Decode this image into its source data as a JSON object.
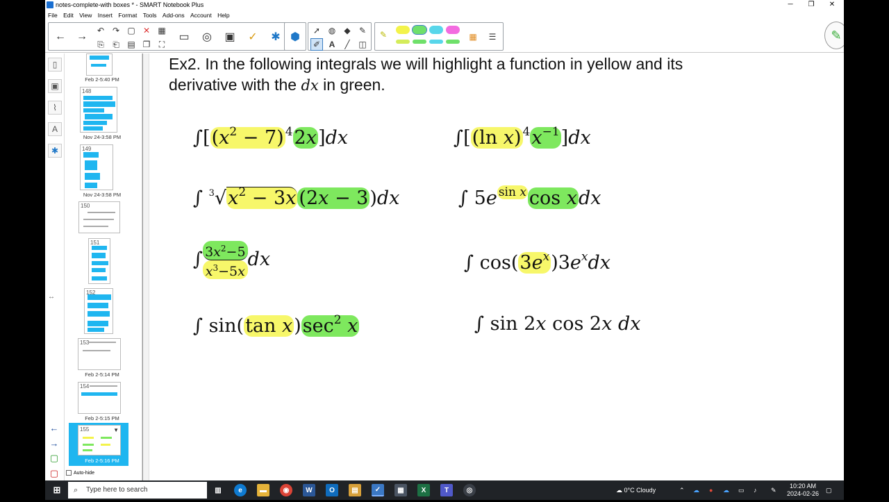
{
  "window": {
    "title": "notes-complete-with boxes * - SMART Notebook Plus",
    "minimize": "─",
    "restore": "❐",
    "close": "✕"
  },
  "menu": [
    "File",
    "Edit",
    "View",
    "Insert",
    "Format",
    "Tools",
    "Add-ons",
    "Account",
    "Help"
  ],
  "toolbar": {
    "buttons": [
      {
        "name": "previous-page-button",
        "glyph": "←"
      },
      {
        "name": "next-page-button",
        "glyph": "→"
      },
      {
        "name": "undo-button",
        "glyph": "↶"
      },
      {
        "name": "redo-button",
        "glyph": "↷"
      },
      {
        "name": "add-page-button",
        "glyph": "▢"
      },
      {
        "name": "delete-button",
        "glyph": "✕"
      },
      {
        "name": "table-button",
        "glyph": "▦"
      },
      {
        "name": "screen-shade-button",
        "glyph": "▭"
      },
      {
        "name": "capture-button",
        "glyph": "◎"
      },
      {
        "name": "document-camera-button",
        "glyph": "▣"
      },
      {
        "name": "response-button",
        "glyph": "✓"
      },
      {
        "name": "addons-button",
        "glyph": "✱"
      },
      {
        "name": "lab-button",
        "glyph": "⬢"
      }
    ],
    "tools": [
      {
        "name": "select-tool",
        "glyph": "➚"
      },
      {
        "name": "shapes-tool",
        "glyph": "◍"
      },
      {
        "name": "fill-tool",
        "glyph": "◆"
      },
      {
        "name": "magic-pen-tool",
        "glyph": "✎"
      },
      {
        "name": "pen-tool",
        "glyph": "✐"
      },
      {
        "name": "text-tool",
        "glyph": "A"
      },
      {
        "name": "line-tool",
        "glyph": "╱"
      },
      {
        "name": "eraser-tool",
        "glyph": "◫"
      }
    ],
    "pen_colors": [
      "#f3f34a",
      "#f3f34a",
      "#6fe06a",
      "#58d6ea",
      "#f36be0"
    ],
    "pen_colors_bottom": [
      "#d4ec5a",
      "#f3f34a",
      "#6fe06a",
      "#58d6ea",
      "#6fe06a"
    ]
  },
  "sidebar": {
    "thumbs": [
      {
        "num": "",
        "label": "Feb 2-5:40 PM"
      },
      {
        "num": "148",
        "label": "Nov 24-3:58 PM"
      },
      {
        "num": "149",
        "label": "Nov 24-3:58 PM"
      },
      {
        "num": "150",
        "label": ""
      },
      {
        "num": "151",
        "label": ""
      },
      {
        "num": "152",
        "label": ""
      },
      {
        "num": "153",
        "label": "Feb 2-5:14 PM"
      },
      {
        "num": "154",
        "label": "Feb 2-5:15 PM"
      },
      {
        "num": "155",
        "label": "Feb 2-5:16 PM"
      }
    ],
    "autohide": "Auto-hide"
  },
  "page": {
    "heading_line1": "Ex2. In the following integrals we will highlight a function in yellow and its",
    "heading_line2_pre": "derivative with the ",
    "heading_line2_var": "dx",
    "heading_line2_post": " in green."
  },
  "taskbar": {
    "search_placeholder": "Type here to search",
    "weather": "0°C  Cloudy",
    "time": "10:20 AM",
    "date": "2024-02-26"
  }
}
